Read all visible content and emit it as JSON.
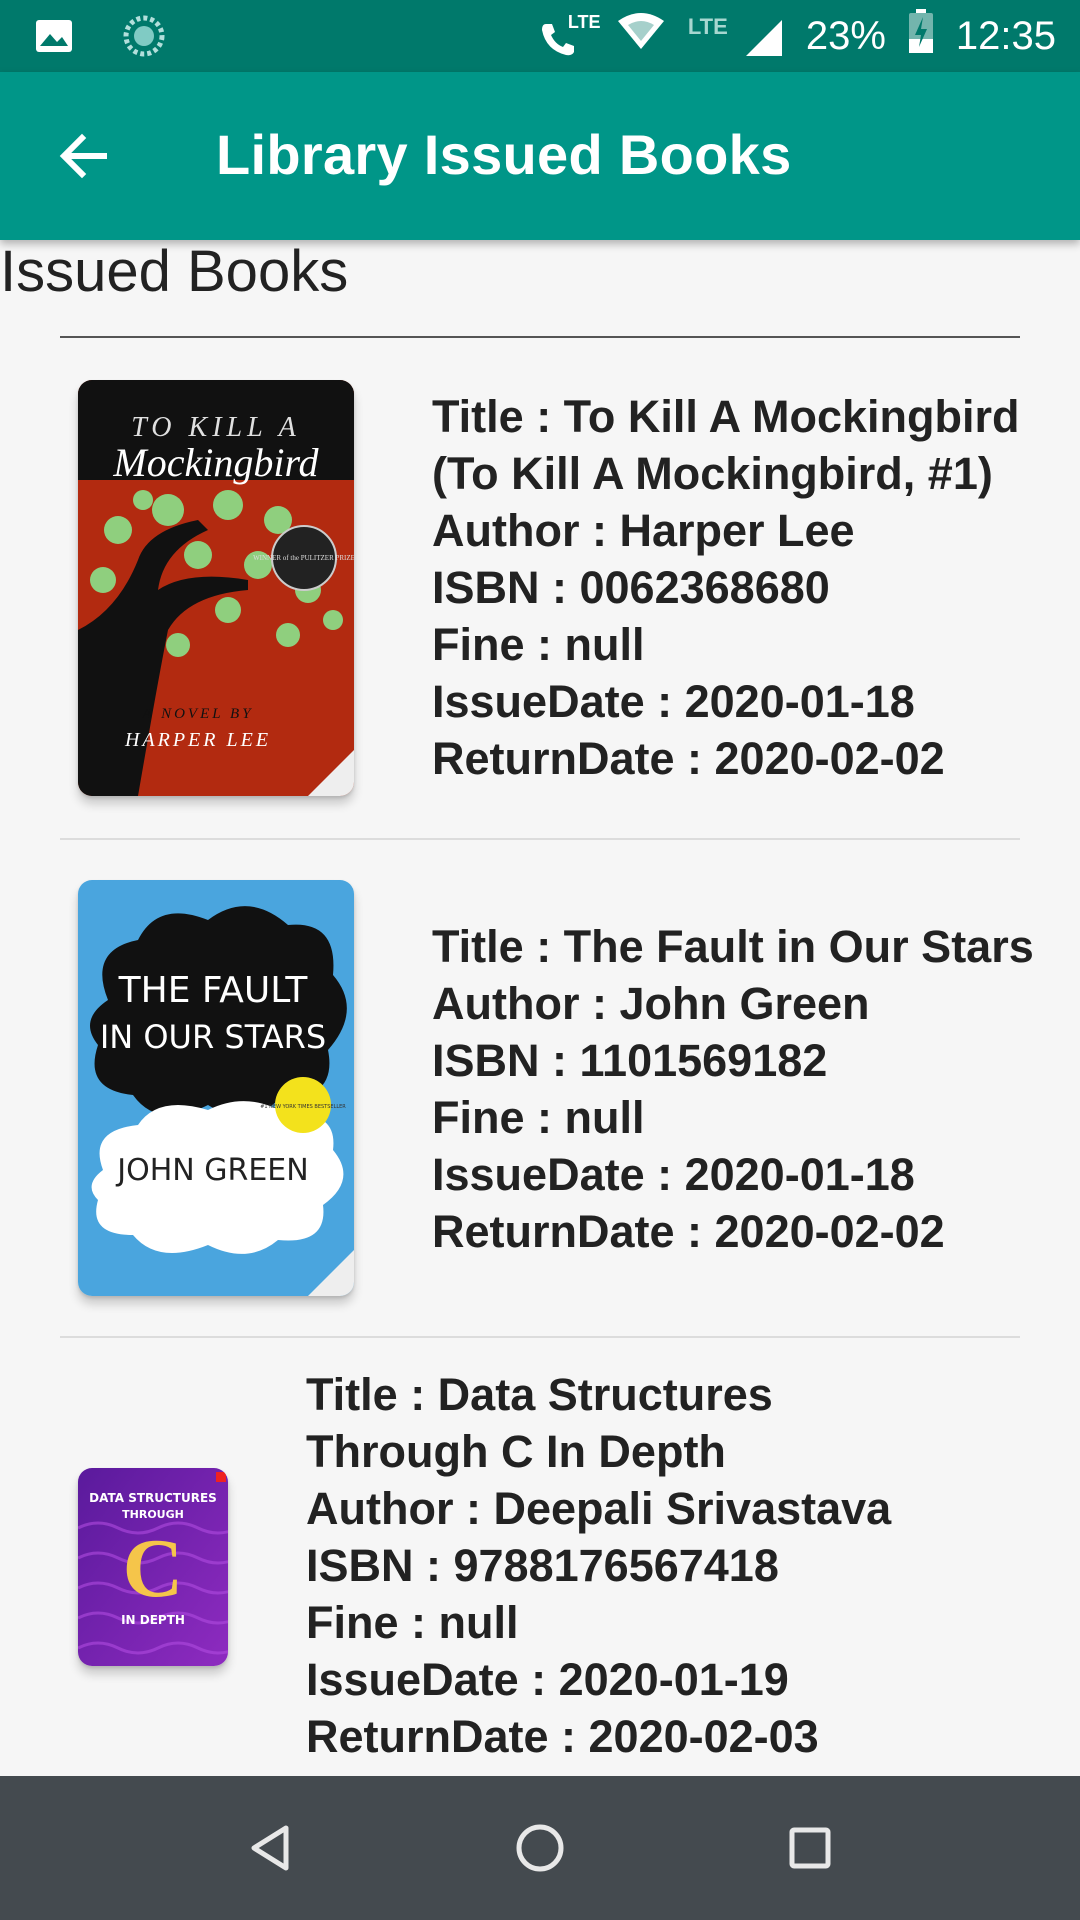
{
  "status_bar": {
    "call_label": "LTE",
    "network_label": "LTE",
    "battery": "23%",
    "time": "12:35"
  },
  "app_bar": {
    "title": "Library Issued Books"
  },
  "section_title": "Issued Books",
  "books": [
    {
      "title_line1": "Title : To Kill A Mockingbird",
      "title_line2": "(To Kill A Mockingbird, #1)",
      "author": "Author : Harper Lee",
      "isbn": "ISBN : 0062368680",
      "fine": "Fine : null",
      "issue_date": "IssueDate : 2020-01-18",
      "return_date": "ReturnDate : 2020-02-02",
      "cover": {
        "top": "TO KILL A",
        "script": "Mockingbird",
        "novel_by": "A NOVEL BY",
        "author": "HARPER LEE",
        "badge": "WINNER of the PULITZER PRIZE"
      }
    },
    {
      "title_line1": "Title : The Fault in Our Stars",
      "author": "Author : John Green",
      "isbn": "ISBN : 1101569182",
      "fine": "Fine : null",
      "issue_date": "IssueDate : 2020-01-18",
      "return_date": "ReturnDate : 2020-02-02",
      "cover": {
        "line1": "THE FAULT",
        "line2": "IN OUR STARS",
        "author": "JOHN GREEN",
        "badge": "#1 NEW YORK TIMES BESTSELLER"
      }
    },
    {
      "title_line1": "Title : Data Structures",
      "title_line2": "Through C In Depth",
      "author": "Author : Deepali Srivastava",
      "isbn": "ISBN : 9788176567418",
      "fine": "Fine : null",
      "issue_date": "IssueDate : 2020-01-19",
      "return_date": "ReturnDate : 2020-02-03",
      "cover": {
        "line1": "DATA STRUCTURES",
        "line2": "THROUGH",
        "letter": "C",
        "line3": "IN DEPTH"
      }
    }
  ],
  "icons": {
    "back": "arrow-left-icon",
    "nav_back": "triangle-back-icon",
    "nav_home": "circle-home-icon",
    "nav_recents": "square-recents-icon"
  },
  "colors": {
    "status_bar": "#00796b",
    "app_bar": "#009688",
    "nav_bar": "#444a4f",
    "background": "#f6f6f6"
  }
}
